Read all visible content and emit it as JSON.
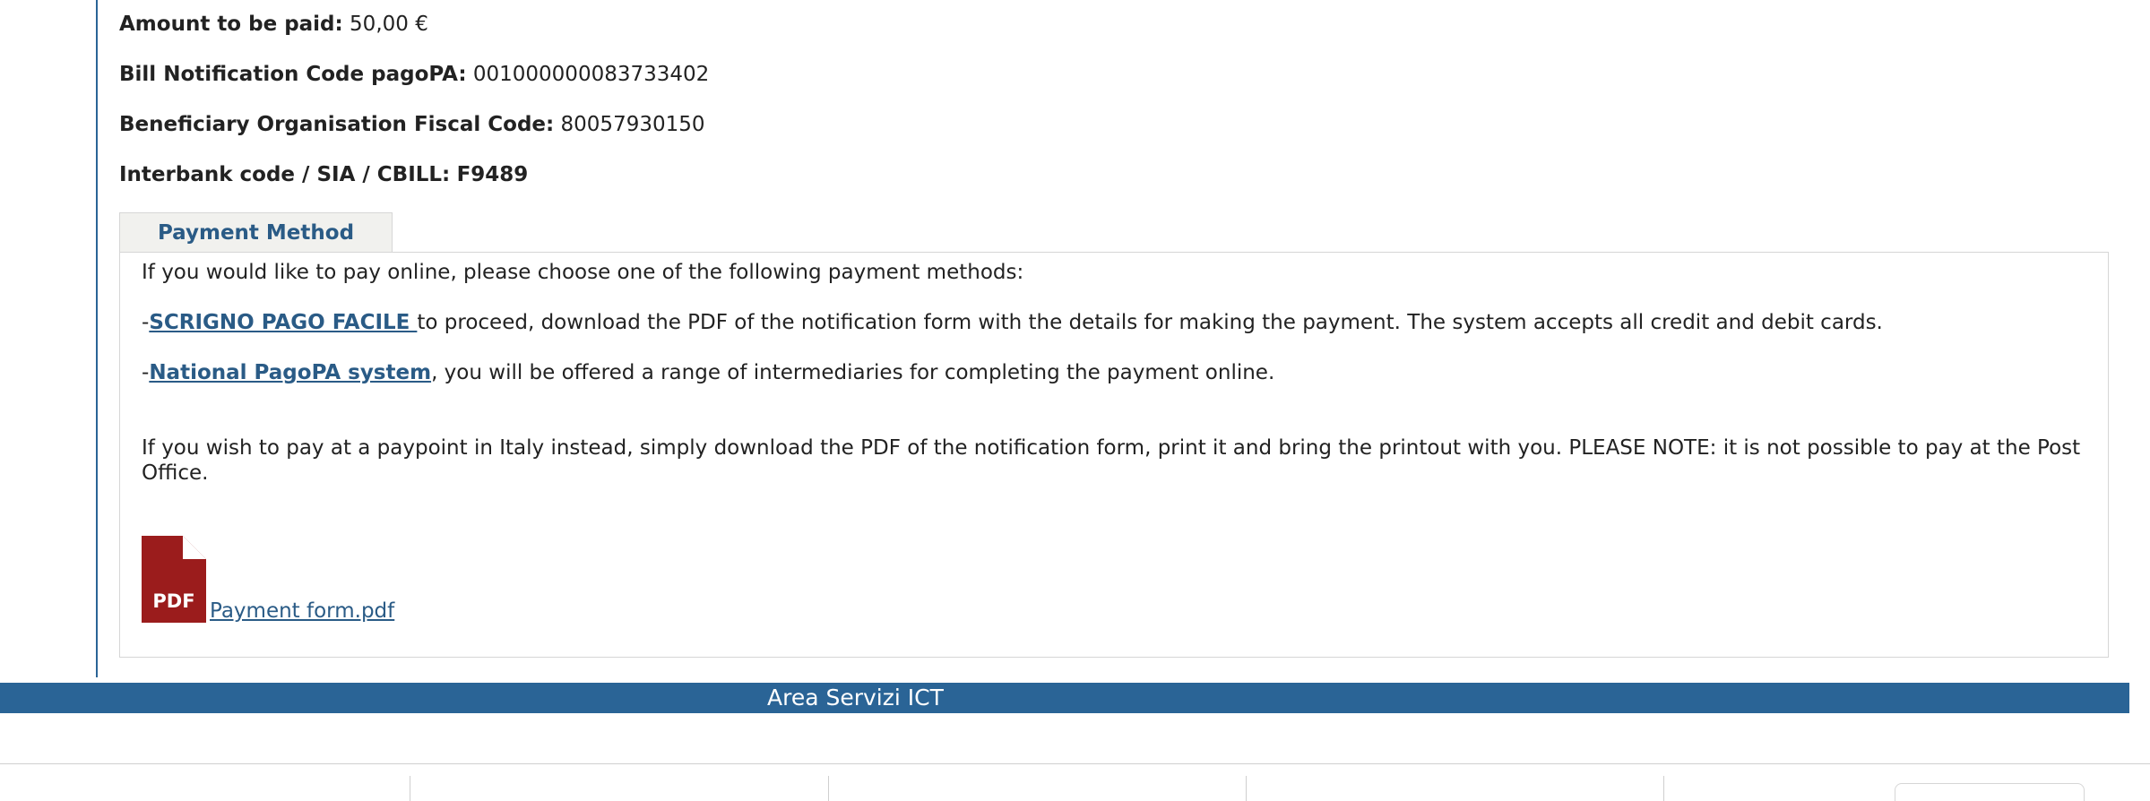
{
  "details": {
    "amount_label": "Amount to be paid:",
    "amount_value": "50,00 €",
    "notice_label": "Bill Notification Code pagoPA:",
    "notice_value": "001000000083733402",
    "fiscal_label": "Beneficiary Organisation Fiscal Code:",
    "fiscal_value": "80057930150",
    "interbank_label": "Interbank code / SIA / CBILL:",
    "interbank_value": "F9489"
  },
  "payment_method": {
    "tab_label": "Payment Method",
    "intro": "If you would like to pay online, please choose one of the following payment methods:",
    "option1_dash": "-",
    "option1_link": "SCRIGNO PAGO FACILE ",
    "option1_text": "to proceed, download the PDF of the notification form with the details for making the payment. The system accepts all credit and debit cards.",
    "option2_dash": "-",
    "option2_link": "National PagoPA system",
    "option2_text": ", you will be offered a range of intermediaries for completing the payment online.",
    "paypoint_text": "If you wish to pay at a paypoint in Italy instead, simply download the PDF of the notification form, print it and bring the printout with you. PLEASE NOTE: it is not possible to pay at the Post Office.",
    "pdf_icon_label": "PDF",
    "pdf_link": " Payment form.pdf"
  },
  "footer": {
    "title": "Area Servizi ICT"
  },
  "colors": {
    "accent": "#2a6496",
    "link": "#2a5b86",
    "pdf_red": "#9b1c1c"
  },
  "icons": {
    "pdf": "pdf-file-icon"
  }
}
